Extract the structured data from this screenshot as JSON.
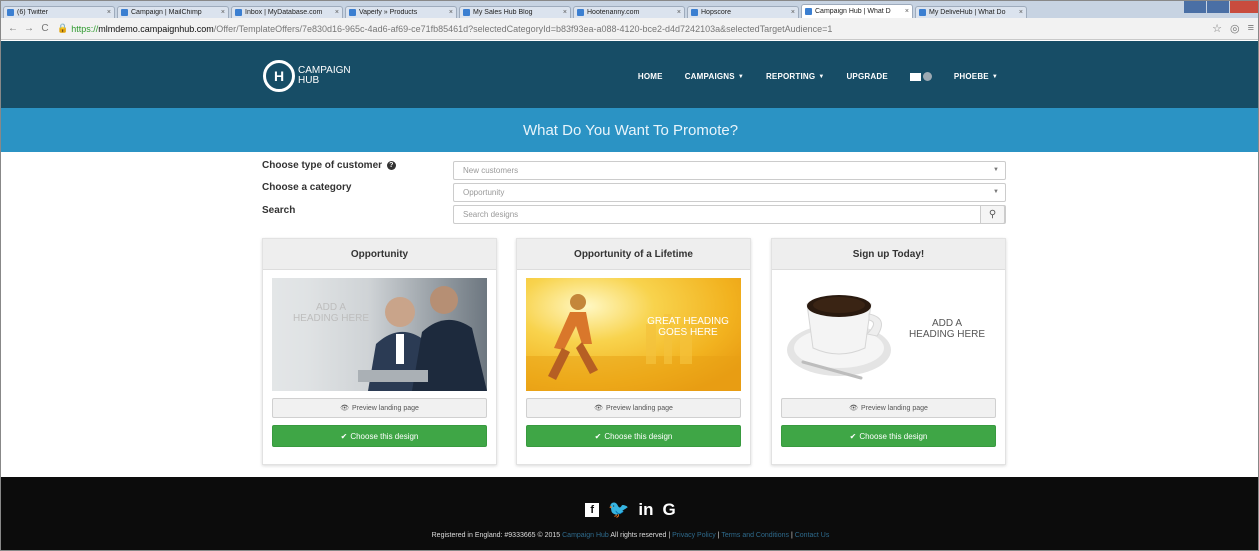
{
  "browser": {
    "tabs": [
      {
        "label": "(6) Twitter",
        "active": false
      },
      {
        "label": "Campaign | MailChimp",
        "active": false
      },
      {
        "label": "Inbox | MyDatabase.com",
        "active": false
      },
      {
        "label": "Vapeify » Products",
        "active": false
      },
      {
        "label": "My Sales Hub Blog",
        "active": false
      },
      {
        "label": "Hootenanny.com",
        "active": false
      },
      {
        "label": "Hopscore",
        "active": false
      },
      {
        "label": "Campaign Hub | What D",
        "active": true
      },
      {
        "label": "My DeliveHub | What Do",
        "active": false
      }
    ],
    "url_scheme": "https://",
    "url_host": "mlmdemo.campaignhub.com",
    "url_path": "/Offer/TemplateOffers/7e830d16-965c-4ad6-af69-ce71fb85461d?selectedCategoryId=b83f93ea-a088-4120-bce2-d4d7242103a&selectedTargetAudience=1"
  },
  "header": {
    "logo_letter": "H",
    "logo_line1": "CAMPAIGN",
    "logo_line2": "HUB",
    "nav": [
      {
        "label": "HOME",
        "dropdown": false
      },
      {
        "label": "CAMPAIGNS",
        "dropdown": true
      },
      {
        "label": "REPORTING",
        "dropdown": true
      },
      {
        "label": "UPGRADE",
        "dropdown": false
      }
    ],
    "user_label": "PHOEBE"
  },
  "banner": {
    "title": "What Do You Want To Promote?"
  },
  "form": {
    "customer_label": "Choose type of customer",
    "customer_value": "New customers",
    "category_label": "Choose a category",
    "category_value": "Opportunity",
    "search_label": "Search",
    "search_placeholder": "Search designs"
  },
  "cards": [
    {
      "title": "Opportunity",
      "heading_line1": "ADD A",
      "heading_line2": "HEADING HERE",
      "preview_label": "Preview landing page",
      "choose_label": "Choose this design"
    },
    {
      "title": "Opportunity of a Lifetime",
      "heading_line1": "GREAT HEADING",
      "heading_line2": "GOES HERE",
      "preview_label": "Preview landing page",
      "choose_label": "Choose this design"
    },
    {
      "title": "Sign up Today!",
      "heading_line1": "ADD A",
      "heading_line2": "HEADING HERE",
      "preview_label": "Preview landing page",
      "choose_label": "Choose this design"
    }
  ],
  "footer": {
    "social": [
      "facebook",
      "twitter",
      "linkedin",
      "google"
    ],
    "twitter_glyph": "🐦",
    "linkedin_glyph": "in",
    "google_glyph": "G",
    "text_prefix": "Registered in England: #9333665 © 2015",
    "brand_link": "Campaign Hub",
    "rights_text": "All rights reserved",
    "privacy_link": "Privacy Policy",
    "terms_link": "Terms and Conditions",
    "contact_link": "Contact Us"
  },
  "colors": {
    "header_bg": "#174d66",
    "banner_bg": "#2b93c4",
    "choose_btn": "#3fa646",
    "footer_bg": "#0c0c0c"
  }
}
